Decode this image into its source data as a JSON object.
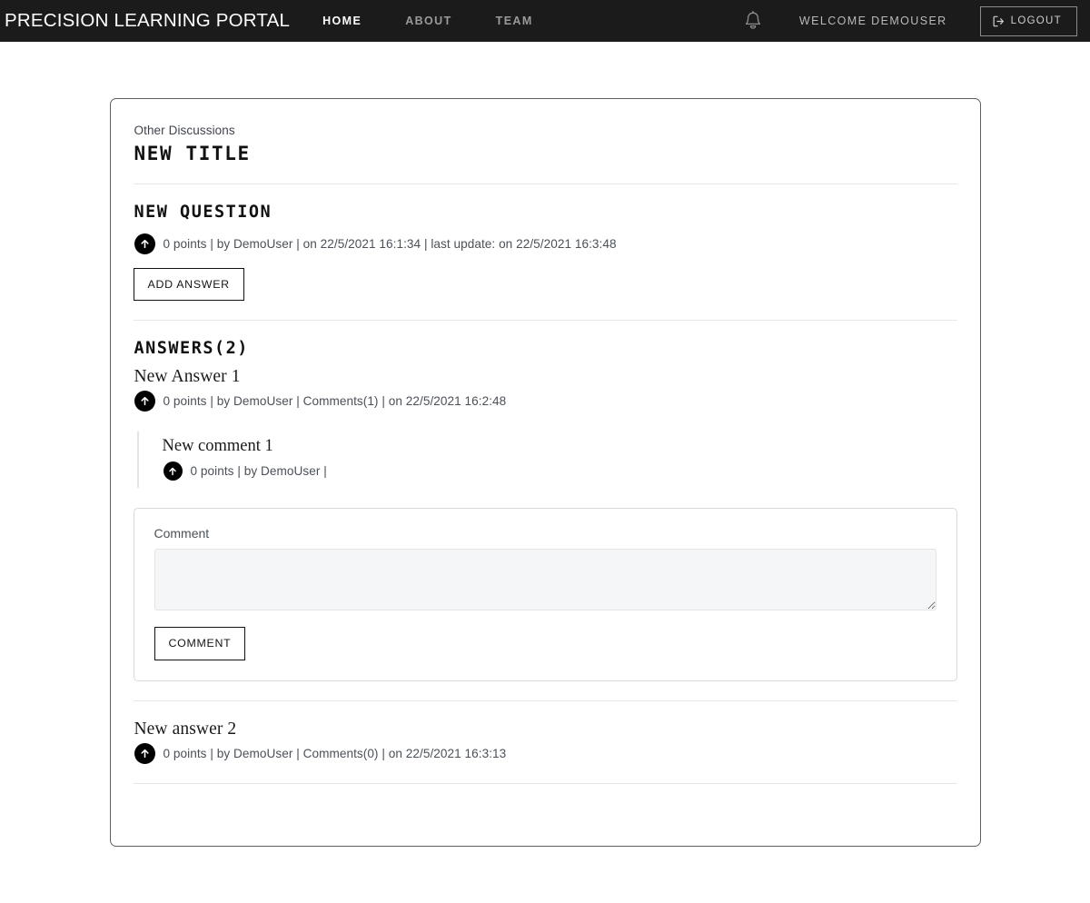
{
  "navbar": {
    "brand": "PRECISION LEARNING PORTAL",
    "links": [
      {
        "label": "HOME",
        "active": true
      },
      {
        "label": "ABOUT",
        "active": false
      },
      {
        "label": "TEAM",
        "active": false
      }
    ],
    "bell_icon": "bell-icon",
    "welcome": "WELCOME DEMOUSER",
    "logout_label": "LOGOUT",
    "logout_icon": "sign-out-icon",
    "background_color": "#1b1b1b",
    "active_link_color": "#ffffff",
    "inactive_link_color": "#9a9a9a"
  },
  "discussion": {
    "breadcrumb": "Other Discussions",
    "title": "NEW TITLE",
    "question": {
      "title": "NEW QUESTION",
      "points": "0 points",
      "meta": "0 points | by DemoUser | on 22/5/2021 16:1:34 | last update: on 22/5/2021 16:3:48",
      "author": "DemoUser",
      "created": "22/5/2021 16:1:34",
      "last_update": "22/5/2021 16:3:48",
      "upvote_icon": "arrow-up-icon",
      "add_answer_label": "ADD ANSWER"
    },
    "answers_heading": "ANSWERS(2)",
    "answers": [
      {
        "body": "New Answer 1",
        "meta": "0 points | by DemoUser | Comments(1) | on 22/5/2021 16:2:48",
        "points": "0 points",
        "author": "DemoUser",
        "comments_label": "Comments(1)",
        "created": "22/5/2021 16:2:48",
        "upvote_icon": "arrow-up-icon",
        "comments": [
          {
            "body": "New comment 1",
            "meta": "0 points | by DemoUser |",
            "points": "0 points",
            "author": "DemoUser",
            "upvote_icon": "arrow-up-icon"
          }
        ],
        "comment_form": {
          "label": "Comment",
          "value": "",
          "placeholder": "",
          "submit_label": "COMMENT"
        }
      },
      {
        "body": "New answer 2",
        "meta": "0 points | by DemoUser | Comments(0) | on 22/5/2021 16:3:13",
        "points": "0 points",
        "author": "DemoUser",
        "comments_label": "Comments(0)",
        "created": "22/5/2021 16:3:13",
        "upvote_icon": "arrow-up-icon"
      }
    ]
  }
}
